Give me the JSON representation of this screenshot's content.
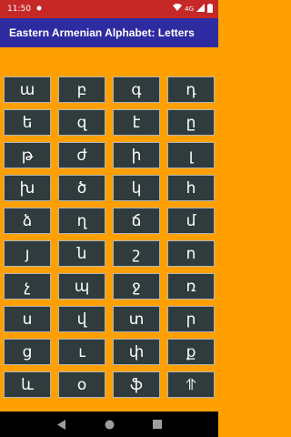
{
  "status": {
    "time": "11:50",
    "network": "4G",
    "icons": [
      "notification-dot-icon",
      "wifi-icon",
      "signal-icon",
      "battery-icon"
    ]
  },
  "app_bar": {
    "title": "Eastern Armenian Alphabet: Letters"
  },
  "letters": [
    "ա",
    "բ",
    "գ",
    "դ",
    "ե",
    "զ",
    "է",
    "ը",
    "թ",
    "ժ",
    "ի",
    "լ",
    "խ",
    "ծ",
    "կ",
    "հ",
    "ձ",
    "ղ",
    "ճ",
    "մ",
    "յ",
    "ն",
    "շ",
    "ո",
    "չ",
    "պ",
    "ջ",
    "ռ",
    "ս",
    "վ",
    "տ",
    "ր",
    "ց",
    "ւ",
    "փ",
    "ք",
    "և",
    "օ",
    "ֆ",
    "⥣"
  ],
  "nav": [
    "back-icon",
    "home-icon",
    "recents-icon"
  ],
  "colors": {
    "status_bar": "#c62828",
    "app_bar": "#2e2ba0",
    "background": "#ffa000",
    "tile": "#2f3b3d"
  }
}
